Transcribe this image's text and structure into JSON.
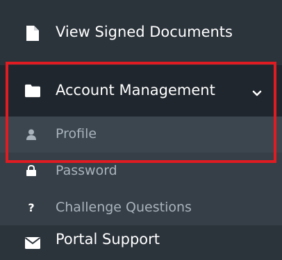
{
  "menu": {
    "view_signed": {
      "label": "View Signed Documents",
      "icon": "file-icon"
    },
    "account": {
      "label": "Account Management",
      "icon": "folder-icon",
      "expanded": true,
      "items": [
        {
          "label": "Profile",
          "icon": "user-icon",
          "active": true
        },
        {
          "label": "Password",
          "icon": "lock-icon"
        },
        {
          "label": "Challenge Questions",
          "icon": "question-icon",
          "glyph": "?"
        }
      ]
    },
    "portal_support": {
      "label": "Portal Support",
      "icon": "envelope-icon"
    }
  },
  "colors": {
    "sidebar_bg": "#2b333b",
    "parent_bg": "#1f262d",
    "submenu_bg": "#363f47",
    "highlight": "#e11b22"
  }
}
